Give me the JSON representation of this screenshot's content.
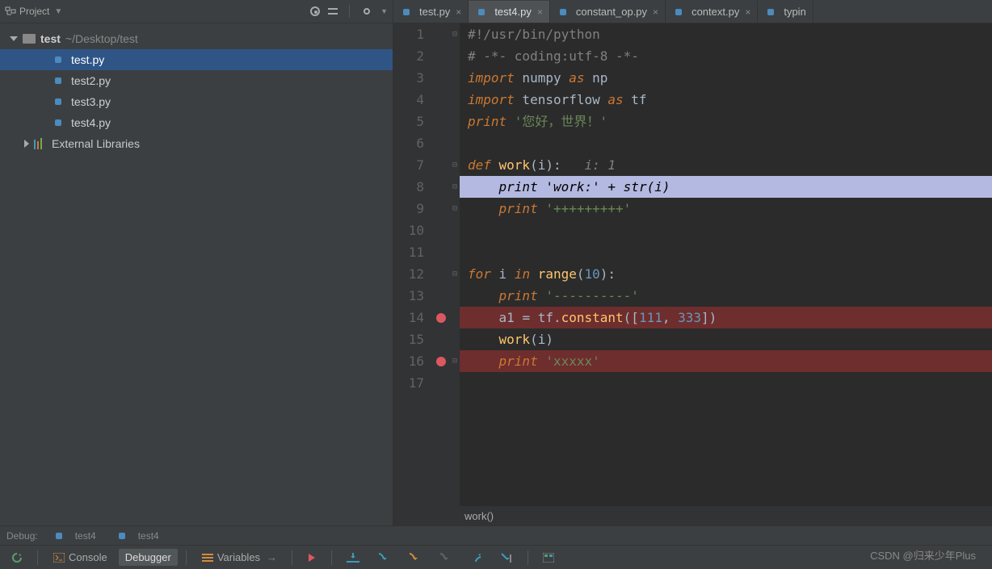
{
  "sidebar": {
    "header": "Project",
    "project_name": "test",
    "project_path": "~/Desktop/test",
    "files": [
      "test.py",
      "test2.py",
      "test3.py",
      "test4.py"
    ],
    "external": "External Libraries"
  },
  "tabs": [
    {
      "label": "test.py"
    },
    {
      "label": "test4.py"
    },
    {
      "label": "constant_op.py"
    },
    {
      "label": "context.py"
    },
    {
      "label": "typin"
    }
  ],
  "editor": {
    "breadcrumb": "work()",
    "lines": [
      {
        "n": 1,
        "fold": "-",
        "tokens": [
          [
            "cm",
            "#!/usr/bin/python"
          ]
        ]
      },
      {
        "n": 2,
        "tokens": [
          [
            "cm",
            "# -*- coding:utf-8 -*-"
          ]
        ]
      },
      {
        "n": 3,
        "tokens": [
          [
            "kw",
            "import"
          ],
          [
            "id",
            " numpy "
          ],
          [
            "kw",
            "as"
          ],
          [
            "id",
            " np"
          ]
        ]
      },
      {
        "n": 4,
        "tokens": [
          [
            "kw",
            "import"
          ],
          [
            "id",
            " tensorflow "
          ],
          [
            "kw",
            "as"
          ],
          [
            "id",
            " tf"
          ]
        ]
      },
      {
        "n": 5,
        "tokens": [
          [
            "kw",
            "print "
          ],
          [
            "str",
            "'您好，世界！'"
          ]
        ]
      },
      {
        "n": 6,
        "tokens": []
      },
      {
        "n": 7,
        "fold": "-",
        "tokens": [
          [
            "kw",
            "def "
          ],
          [
            "fn",
            "work"
          ],
          [
            "op",
            "("
          ],
          [
            "id",
            "i"
          ],
          [
            "op",
            "):   "
          ],
          [
            "param",
            "i: 1"
          ]
        ]
      },
      {
        "n": 8,
        "exec": true,
        "fold": "-",
        "tokens": [
          [
            "id",
            "    "
          ],
          [
            "kw",
            "print "
          ],
          [
            "str",
            "'work:'"
          ],
          [
            "op",
            " + "
          ],
          [
            "fn",
            "str"
          ],
          [
            "op",
            "("
          ],
          [
            "id",
            "i"
          ],
          [
            "op",
            ")"
          ]
        ]
      },
      {
        "n": 9,
        "fold": "-",
        "tokens": [
          [
            "id",
            "    "
          ],
          [
            "kw",
            "print "
          ],
          [
            "str",
            "'+++++++++'"
          ]
        ]
      },
      {
        "n": 10,
        "tokens": []
      },
      {
        "n": 11,
        "tokens": []
      },
      {
        "n": 12,
        "fold": "-",
        "tokens": [
          [
            "kw",
            "for"
          ],
          [
            "id",
            " i "
          ],
          [
            "kw",
            "in"
          ],
          [
            "id",
            " "
          ],
          [
            "fn",
            "range"
          ],
          [
            "op",
            "("
          ],
          [
            "num",
            "10"
          ],
          [
            "op",
            "):"
          ]
        ]
      },
      {
        "n": 13,
        "tokens": [
          [
            "id",
            "    "
          ],
          [
            "kw",
            "print "
          ],
          [
            "str",
            "'----------'"
          ]
        ]
      },
      {
        "n": 14,
        "bp": true,
        "tokens": [
          [
            "id",
            "    a1 "
          ],
          [
            "op",
            "= "
          ],
          [
            "id",
            "tf"
          ],
          [
            "op",
            "."
          ],
          [
            "fn",
            "constant"
          ],
          [
            "op",
            "(["
          ],
          [
            "num",
            "111"
          ],
          [
            "op",
            ", "
          ],
          [
            "num",
            "333"
          ],
          [
            "op",
            "])"
          ]
        ]
      },
      {
        "n": 15,
        "tokens": [
          [
            "id",
            "    "
          ],
          [
            "fn",
            "work"
          ],
          [
            "op",
            "("
          ],
          [
            "id",
            "i"
          ],
          [
            "op",
            ")"
          ]
        ]
      },
      {
        "n": 16,
        "bp": true,
        "fold": "-",
        "tokens": [
          [
            "id",
            "    "
          ],
          [
            "kw",
            "print "
          ],
          [
            "str",
            "'xxxxx'"
          ]
        ]
      },
      {
        "n": 17,
        "tokens": []
      }
    ]
  },
  "debug_strip": {
    "label": "Debug:",
    "sessions": [
      "test4",
      "test4"
    ]
  },
  "toolbar": {
    "console": "Console",
    "debugger": "Debugger",
    "variables": "Variables"
  },
  "watermark": "CSDN @归来少年Plus"
}
